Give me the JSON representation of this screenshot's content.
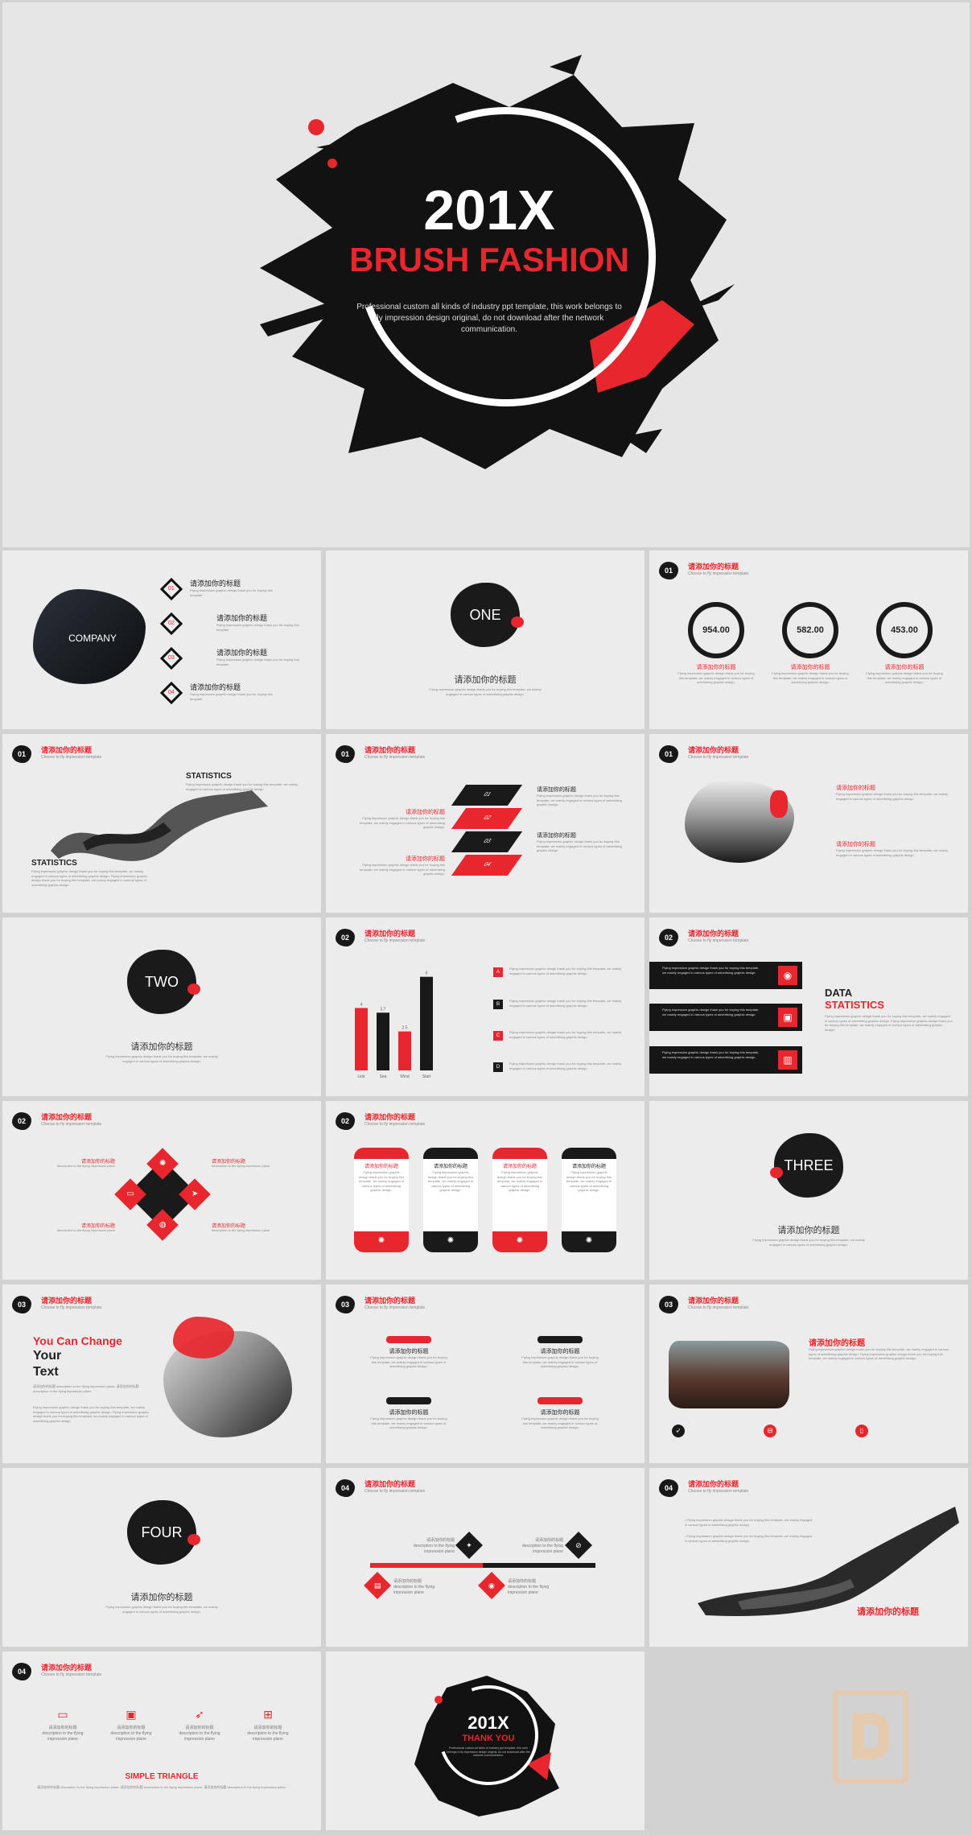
{
  "hero": {
    "year": "201X",
    "title": "BRUSH FASHION",
    "desc": "Professional custom all kinds of industry ppt template, this work belongs to fly impression design original, do not download after the network communication."
  },
  "common": {
    "heading": "请添加你的标题",
    "subtitle": "Choose to fly impression template",
    "add_title": "请添加你的标题",
    "add_title2": "请添加你的标题",
    "short_fly": "Flying impression graphic design thank you for buying this template"
  },
  "s_toc": {
    "company": "COMPANY",
    "items": [
      {
        "num": "01",
        "title": "请添加你的标题",
        "desc": "Flying impression graphic design thank you for buying this template"
      },
      {
        "num": "02",
        "title": "请添加你的标题",
        "desc": "Flying impression graphic design thank you for buying this template"
      },
      {
        "num": "03",
        "title": "请添加你的标题",
        "desc": "Flying impression graphic design thank you for buying this template"
      },
      {
        "num": "04",
        "title": "请添加你的标题",
        "desc": "Flying impression graphic design thank you for buying this template"
      }
    ]
  },
  "sections": [
    {
      "word": "ONE",
      "title": "请添加你的标题",
      "desc": "Flying impression graphic design thank you for buying this template, we mainly engaged in various types of advertising graphic design."
    },
    {
      "word": "TWO",
      "title": "请添加你的标题",
      "desc": "Flying impression graphic design thank you for buying this template, we mainly engaged in various types of advertising graphic design."
    },
    {
      "word": "THREE",
      "title": "请添加你的标题",
      "desc": "Flying impression graphic design thank you for buying this template, we mainly engaged in various types of advertising graphic design."
    },
    {
      "word": "FOUR",
      "title": "请添加你的标题",
      "desc": "Flying impression graphic design thank you for buying this template, we mainly engaged in various types of advertising graphic design."
    }
  ],
  "nums": {
    "n1": "01",
    "n2": "02",
    "n3": "03",
    "n4": "04"
  },
  "circles": [
    {
      "value": "954.00",
      "title": "请添加你的标题",
      "desc": "Flying impression graphic design thank you for buying this template, we mainly engaged in various types of advertising graphic design."
    },
    {
      "value": "582.00",
      "title": "请添加你的标题",
      "desc": "Flying impression graphic design thank you for buying this template, we mainly engaged in various types of advertising graphic design."
    },
    {
      "value": "453.00",
      "title": "请添加你的标题",
      "desc": "Flying impression graphic design thank you for buying this template, we mainly engaged in various types of advertising graphic design."
    }
  ],
  "stats": {
    "label": "STATISTICS",
    "desc": "Flying impression graphic design thank you for buying this template, we mainly engaged in various types of advertising graphic design.",
    "desc_long": "Flying impression graphic design thank you for buying this template, we mainly engaged in various types of advertising graphic design. Flying impression graphic design thank you for buying this template, we mainly engaged in various types of advertising graphic design."
  },
  "layers": [
    "01",
    "02",
    "03",
    "04"
  ],
  "long_desc": "Flying impression graphic design thank you for buying this template, we mainly engaged in various types of advertising graphic design.",
  "chart_data": {
    "type": "bar",
    "categories": [
      "Link",
      "Sea",
      "Wind",
      "Start"
    ],
    "values": [
      4,
      3.7,
      2.5,
      6
    ],
    "value_labels": [
      "4",
      "3.7",
      "2.5",
      "6"
    ],
    "colors": [
      "#e8262d",
      "#181818",
      "#e8262d",
      "#181818"
    ],
    "ylim": [
      0,
      6.5
    ]
  },
  "letters": [
    "A",
    "B",
    "C",
    "D"
  ],
  "data_stats": {
    "word1": "DATA",
    "word2": "STATISTICS"
  },
  "change": {
    "l1": "You Can Change",
    "l2": "Your",
    "l3": "Text",
    "cn": "请添加你的标题 description to the flying impression plane, 请添加你的标题 description to the flying impression plane."
  },
  "triangle": {
    "title": "SIMPLE TRIANGLE",
    "desc": "请添加你的标题 description to the flying impression plane. 请添加你的标题 description to the flying impression plane. 请添加你的标题 description to the flying impression plane."
  },
  "desc_short": "description to the flying impression plane",
  "thanks": {
    "year": "201X",
    "title": "THANK YOU",
    "desc": "Professional custom all kinds of industry ppt template, this work belongs to fly impression design original, do not download after the network communication."
  }
}
